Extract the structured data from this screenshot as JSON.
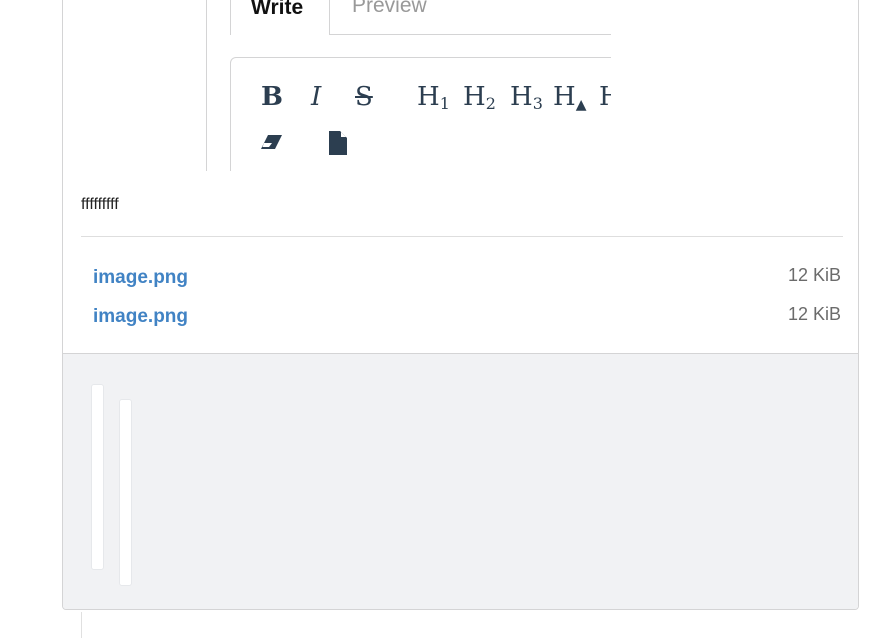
{
  "tabs": {
    "write": "Write",
    "preview": "Preview"
  },
  "toolbar": {
    "bold": "B",
    "italic": "I",
    "strike": "S",
    "h1": "H",
    "h1_sub": "1",
    "h2": "H",
    "h2_sub": "2",
    "h3": "H",
    "h3_sub": "3",
    "heading_bigger": "H",
    "heading_bigger_mark": "▲",
    "heading_cut": "H"
  },
  "comment": {
    "text": "fffffffff"
  },
  "attachments": [
    {
      "name": "image.png",
      "size": "12 KiB"
    },
    {
      "name": "image.png",
      "size": "12 KiB"
    }
  ],
  "colors": {
    "link": "#4183c4",
    "footer_bg": "#f1f2f4",
    "toolbar_icon": "#2c3e50"
  }
}
